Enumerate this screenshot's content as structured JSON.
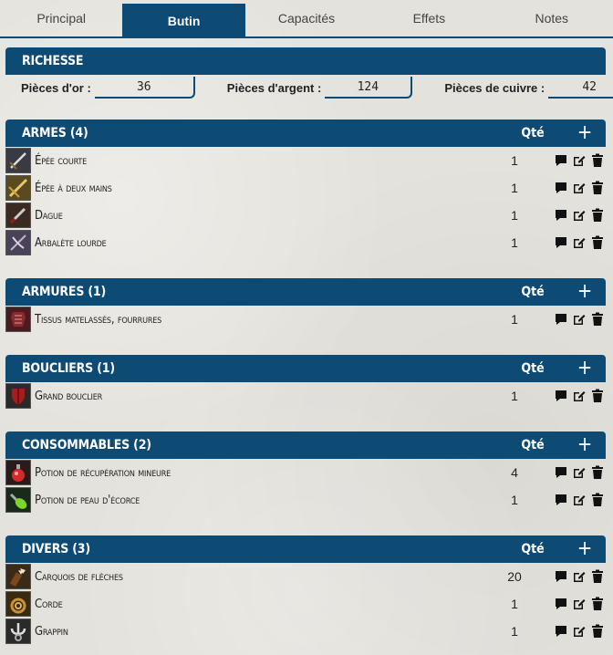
{
  "tabs": [
    {
      "label": "Principal"
    },
    {
      "label": "Butin"
    },
    {
      "label": "Capacités"
    },
    {
      "label": "Effets"
    },
    {
      "label": "Notes"
    }
  ],
  "wealth": {
    "title": "Richesse",
    "gold": {
      "label": "Pièces d'or :",
      "value": "36"
    },
    "silver": {
      "label": "Pièces d'argent :",
      "value": "124"
    },
    "copper": {
      "label": "Pièces de cuivre :",
      "value": "42"
    }
  },
  "sections": {
    "weapons": {
      "title": "Armes (4)",
      "qty": "Qté",
      "add": "+",
      "items": [
        {
          "name": "Épée courte",
          "qty": "1"
        },
        {
          "name": "Épée à deux mains",
          "qty": "1"
        },
        {
          "name": "Dague",
          "qty": "1"
        },
        {
          "name": "Arbalète lourde",
          "qty": "1"
        }
      ]
    },
    "armors": {
      "title": "Armures (1)",
      "qty": "Qté",
      "add": "+",
      "items": [
        {
          "name": "Tissus matelassés, fourrures",
          "qty": "1"
        }
      ]
    },
    "shields": {
      "title": "Boucliers (1)",
      "qty": "Qté",
      "add": "+",
      "items": [
        {
          "name": "Grand bouclier",
          "qty": "1"
        }
      ]
    },
    "consumables": {
      "title": "Consommables (2)",
      "qty": "Qté",
      "add": "+",
      "items": [
        {
          "name": "Potion de récupération mineure",
          "qty": "4"
        },
        {
          "name": "Potion de peau d'écorce",
          "qty": "1"
        }
      ]
    },
    "misc": {
      "title": "Divers (3)",
      "qty": "Qté",
      "add": "+",
      "items": [
        {
          "name": "Carquois de flèches",
          "qty": "20"
        },
        {
          "name": "Corde",
          "qty": "1"
        },
        {
          "name": "Grappin",
          "qty": "1"
        }
      ]
    }
  },
  "colors": {
    "accent": "#0d4a74"
  },
  "icons": {
    "item_actions": [
      "chat-icon",
      "edit-icon",
      "trash-icon"
    ]
  }
}
